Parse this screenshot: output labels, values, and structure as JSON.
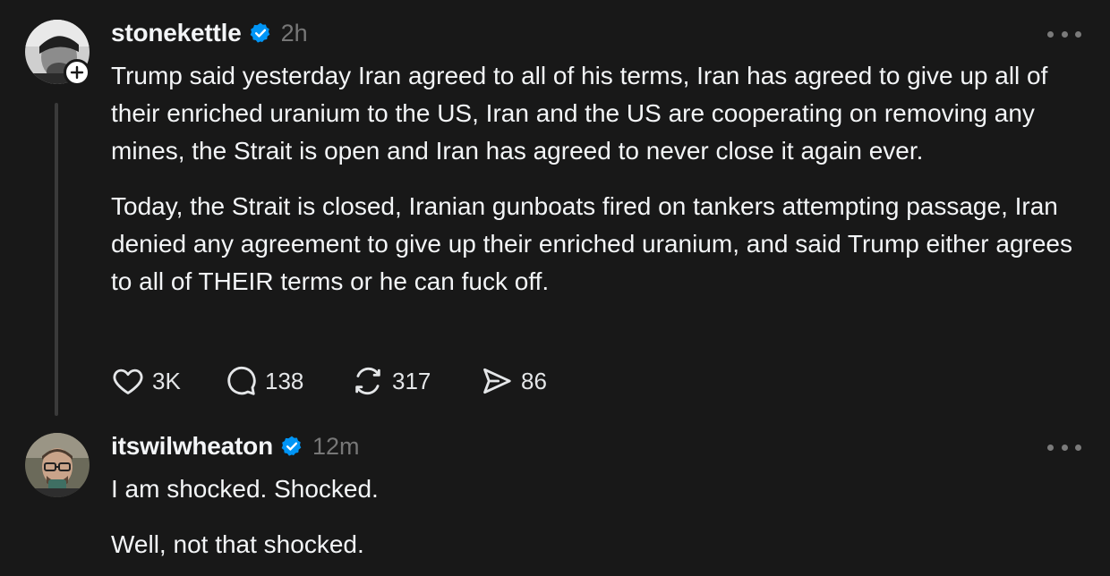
{
  "colors": {
    "background": "#181818",
    "text_primary": "#f3f5f7",
    "text_secondary": "#777777",
    "verified_blue": "#0095f6",
    "thread_line": "#3a3a3a"
  },
  "posts": [
    {
      "username": "stonekettle",
      "verified": true,
      "timestamp": "2h",
      "avatar_icon": "avatar-stonekettle",
      "has_follow_badge": true,
      "paragraphs": [
        "Trump said yesterday Iran agreed to all of his terms, Iran has agreed to give up all of their enriched uranium to the US, Iran and the US are cooperating on removing any mines, the Strait is open and Iran has agreed to never close it again ever.",
        "Today, the Strait is closed, Iranian gunboats fired on tankers attempting passage, Iran denied any agreement to give up their enriched uranium, and said Trump either agrees to all of THEIR terms or he can fuck off."
      ],
      "actions": {
        "likes": "3K",
        "replies": "138",
        "reposts": "317",
        "shares": "86"
      }
    },
    {
      "username": "itswilwheaton",
      "verified": true,
      "timestamp": "12m",
      "avatar_icon": "avatar-itswilwheaton",
      "paragraphs": [
        "I am shocked. Shocked.",
        "Well, not that shocked."
      ]
    }
  ]
}
